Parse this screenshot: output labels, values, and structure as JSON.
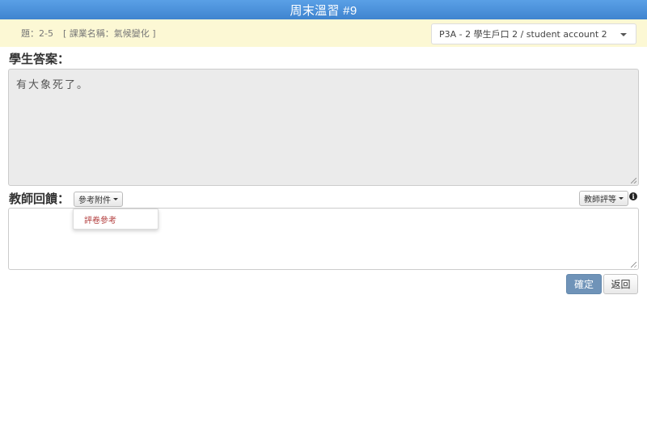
{
  "header": {
    "title": "周末溫習 #9"
  },
  "infobar": {
    "question": "題：2-5",
    "course": "[ 課業名稱：氣候變化 ]"
  },
  "account_select": {
    "selected": "P3A - 2 學生戶口 2 / student account 2"
  },
  "answer": {
    "label": "學生答案：",
    "text": "有大象死了。"
  },
  "feedback": {
    "label": "教師回饋：",
    "attachment_button": "參考附件",
    "attachment_menu": [
      "評卷參考"
    ],
    "grade_button": "教師評等",
    "info_icon": "i",
    "text": ""
  },
  "actions": {
    "confirm": "確定",
    "back": "返回"
  },
  "colors": {
    "header": "#4a90d9",
    "infobar": "#fcf8d4",
    "confirm_button": "#6f93b8",
    "menu_link": "#b23c3c"
  }
}
